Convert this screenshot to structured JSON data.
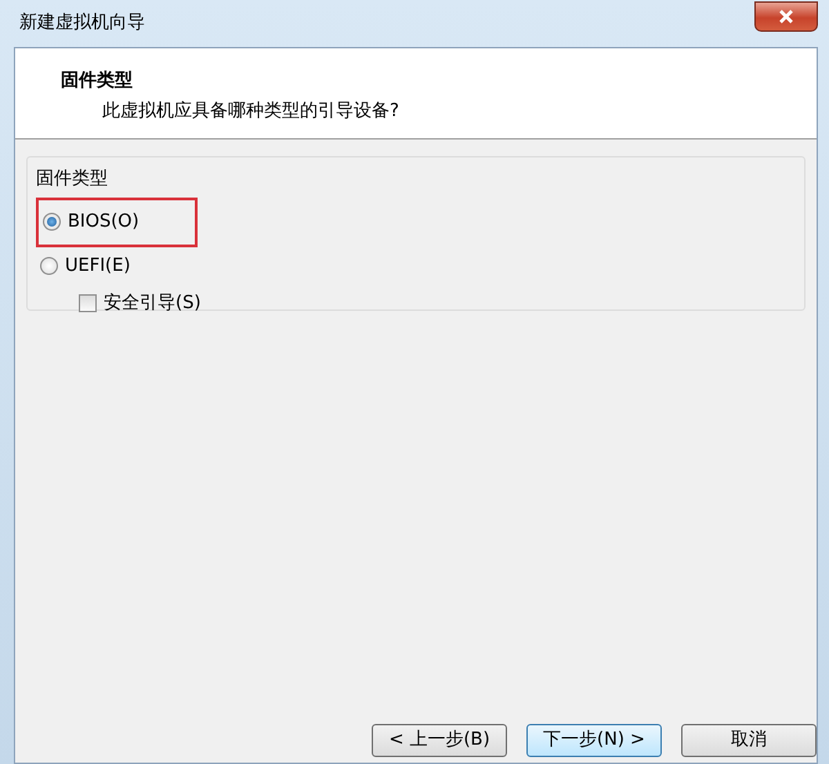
{
  "window": {
    "title": "新建虚拟机向导"
  },
  "header": {
    "title": "固件类型",
    "subtitle": "此虚拟机应具备哪种类型的引导设备?"
  },
  "group": {
    "title": "固件类型",
    "options": [
      {
        "kind": "radio",
        "label": "BIOS(O)",
        "selected": true,
        "highlighted": true
      },
      {
        "kind": "radio",
        "label": "UEFI(E)",
        "selected": false,
        "highlighted": false
      },
      {
        "kind": "checkbox",
        "label": "安全引导(S)",
        "checked": false,
        "highlighted": false
      }
    ]
  },
  "buttons": [
    {
      "label": "< 上一步(B)",
      "default": false
    },
    {
      "label": "下一步(N) >",
      "default": true
    },
    {
      "label": "取消",
      "default": false
    }
  ]
}
